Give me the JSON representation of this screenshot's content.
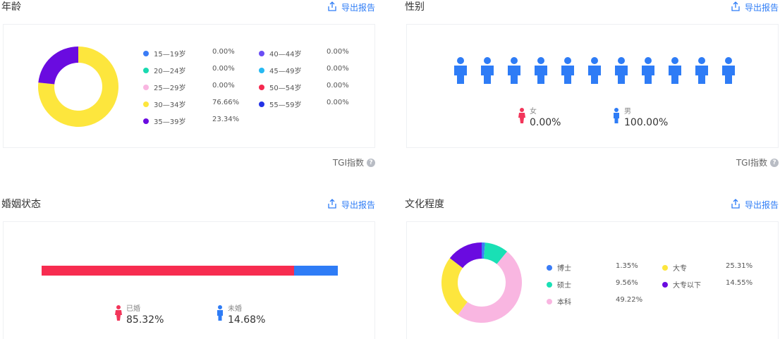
{
  "export_label": "导出报告",
  "tgi_label": "TGI指数",
  "age": {
    "title": "年龄",
    "chart_data": {
      "type": "pie",
      "title": "",
      "slices": [
        {
          "label": "15—19岁",
          "value": 0.0,
          "display": "0.00%",
          "color": "#3a7cf6"
        },
        {
          "label": "20—24岁",
          "value": 0.0,
          "display": "0.00%",
          "color": "#19d9b0"
        },
        {
          "label": "25—29岁",
          "value": 0.0,
          "display": "0.00%",
          "color": "#f9b6e1"
        },
        {
          "label": "30—34岁",
          "value": 76.66,
          "display": "76.66%",
          "color": "#fde63d"
        },
        {
          "label": "35—39岁",
          "value": 23.34,
          "display": "23.34%",
          "color": "#6a0be0"
        },
        {
          "label": "40—44岁",
          "value": 0.0,
          "display": "0.00%",
          "color": "#6a4ef5"
        },
        {
          "label": "45—49岁",
          "value": 0.0,
          "display": "0.00%",
          "color": "#26b9f2"
        },
        {
          "label": "50—54岁",
          "value": 0.0,
          "display": "0.00%",
          "color": "#f5294f"
        },
        {
          "label": "55—59岁",
          "value": 0.0,
          "display": "0.00%",
          "color": "#2433e6"
        }
      ]
    }
  },
  "gender": {
    "title": "性别",
    "people_count": 11,
    "female": {
      "label": "女",
      "value": "0.00%",
      "color": "#f2355a"
    },
    "male": {
      "label": "男",
      "value": "100.00%",
      "color": "#2e7cf6"
    }
  },
  "marriage": {
    "title": "婚姻状态",
    "chart_data": {
      "type": "bar",
      "orientation": "stacked-horizontal",
      "segments": [
        {
          "label": "已婚",
          "value": 85.32,
          "display": "85.32%",
          "color": "#f72c50"
        },
        {
          "label": "未婚",
          "value": 14.68,
          "display": "14.68%",
          "color": "#2e7cf6"
        }
      ]
    }
  },
  "education": {
    "title": "文化程度",
    "chart_data": {
      "type": "pie",
      "title": "",
      "slices": [
        {
          "label": "博士",
          "value": 1.35,
          "display": "1.35%",
          "color": "#3a7cf6"
        },
        {
          "label": "硕士",
          "value": 9.56,
          "display": "9.56%",
          "color": "#19e0b5"
        },
        {
          "label": "本科",
          "value": 49.22,
          "display": "49.22%",
          "color": "#f9b6e1"
        },
        {
          "label": "大专",
          "value": 25.31,
          "display": "25.31%",
          "color": "#fde63d"
        },
        {
          "label": "大专以下",
          "value": 14.55,
          "display": "14.55%",
          "color": "#6a0be0"
        }
      ]
    }
  }
}
